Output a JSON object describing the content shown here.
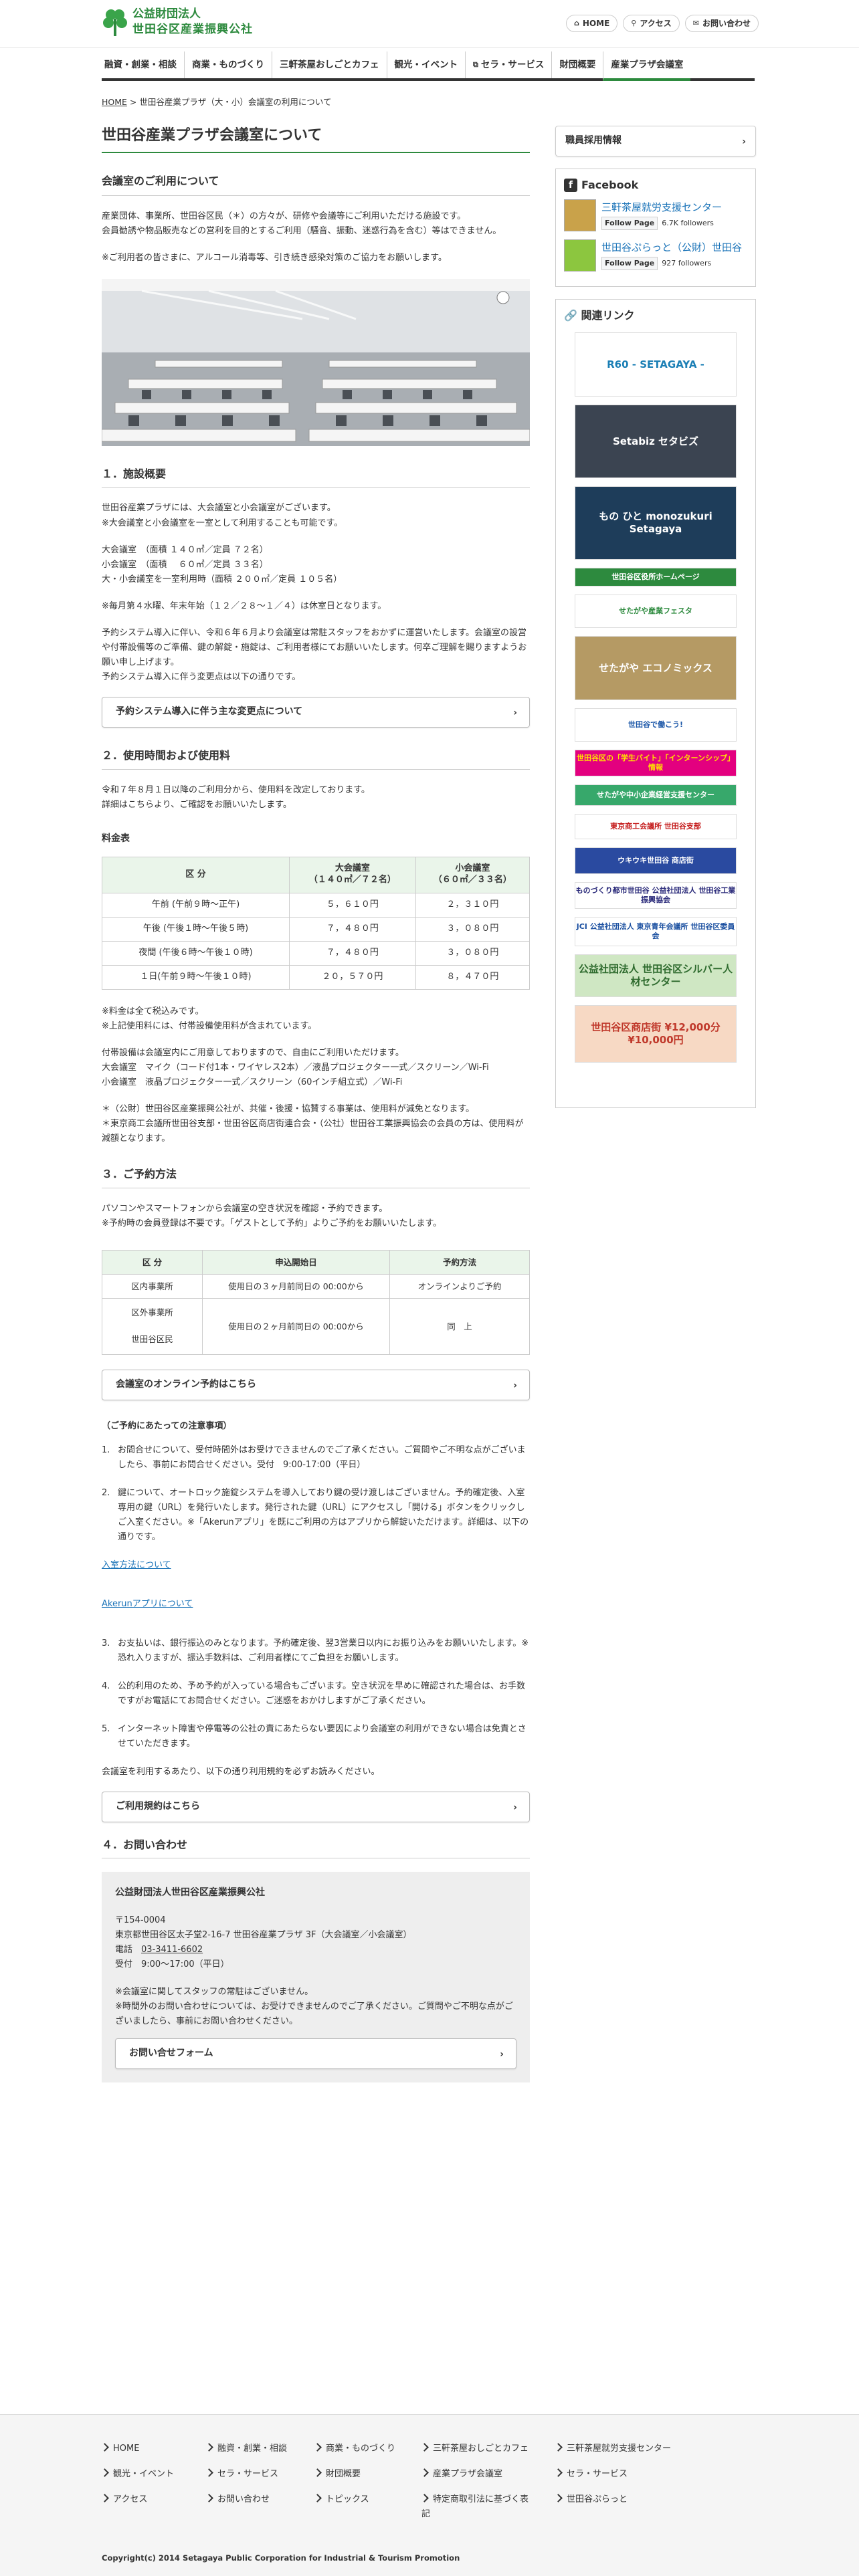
{
  "header": {
    "org_line1": "公益財団法人",
    "org_line2": "世田谷区産業振興公社",
    "links": [
      "HOME",
      "アクセス",
      "お問い合わせ"
    ]
  },
  "nav": [
    "融資・創業・相談",
    "商業・ものづくり",
    "三軒茶屋おしごとカフェ",
    "観光・イベント",
    "セラ・サービス",
    "財団概要",
    "産業プラザ会議室"
  ],
  "breadcrumb": {
    "home": "HOME",
    "sep": ">",
    "current": "世田谷産業プラザ（大・小）会議室の利用について"
  },
  "main": {
    "title": "世田谷産業プラザ会議室について",
    "usage_heading": "会議室のご利用について",
    "usage_p1": "産業団体、事業所、世田谷区民（＊）の方々が、研修や会議等にご利用いただける施設です。",
    "usage_p2": "会員勧誘や物品販売などの営利を目的とするご利用（騒音、振動、迷惑行為を含む）等はできません。",
    "usage_p3": "※ご利用者の皆さまに、アルコール消毒等、引き続き感染対策のご協力をお願いします。",
    "s1_title": "１．施設概要",
    "s1_p1": "世田谷産業プラザには、大会議室と小会議室がございます。",
    "s1_p2": "※大会議室と小会議室を一室として利用することも可能です。",
    "s1_l1": "大会議室　（面積 １４０㎡／定員 ７２名）",
    "s1_l2": "小会議室　（面積　 ６０㎡／定員 ３３名）",
    "s1_l3": "大・小会議室を一室利用時（面積 ２００㎡／定員 １０５名）",
    "s1_p3": "※毎月第４水曜、年末年始（１２／２８〜１／４）は休室日となります。",
    "s1_p4": "予約システム導入に伴い、令和６年６月より会議室は常駐スタッフをおかずに運営いたします。会議室の設営や付帯設備等のご準備、鍵の解錠・施錠は、ご利用者様にてお願いいたします。何卒ご理解を賜りますようお願い申し上げます。",
    "s1_p5": "予約システム導入に伴う変更点は以下の通りです。",
    "btn_changes": "予約システム導入に伴う主な変更点について",
    "s2_title": "２．使用時間および使用料",
    "s2_p1": "令和７年８月１日以降のご利用分から、使用料を改定しております。",
    "s2_p2": "詳細はこちらより、ご確認をお願いいたします。",
    "fee_heading": "料金表",
    "fee_headers": [
      "区 分",
      "大会議室\n（１４０㎡／７２名）",
      "小会議室\n（６０㎡／３３名）"
    ],
    "fee_rows": [
      [
        "午前 (午前９時〜正午)",
        "５，６１０円",
        "２，３１０円"
      ],
      [
        "午後 (午後１時〜午後５時)",
        "７，４８０円",
        "３，０８０円"
      ],
      [
        "夜間 (午後６時〜午後１０時)",
        "７，４８０円",
        "３，０８０円"
      ],
      [
        "１日(午前９時〜午後１０時)",
        "２０，５７０円",
        "８，４７０円"
      ]
    ],
    "fee_n1": "※料金は全て税込みです。",
    "fee_n2": "※上記使用料には、付帯設備使用料が含まれています。",
    "equip_p1": "付帯設備は会議室内にご用意しておりますので、自由にご利用いただけます。",
    "equip_p2": "大会議室　マイク（コード付1本・ワイヤレス2本）／液晶プロジェクター一式／スクリーン／Wi-Fi",
    "equip_p3": "小会議室　液晶プロジェクター一式／スクリーン（60インチ組立式）／Wi-Fi",
    "member_p1": "＊（公財）世田谷区産業振興公社が、共催・後援・協賛する事業は、使用料が減免となります。",
    "member_p2": "＊東京商工会議所世田谷支部・世田谷区商店街連合会・（公社）世田谷工業振興協会の会員の方は、使用料が減額となります。",
    "s3_title": "３．ご予約方法",
    "s3_p1": "パソコンやスマートフォンから会議室の空き状況を確認・予約できます。",
    "s3_p2": "※予約時の会員登録は不要です。「ゲストとして予約」よりご予約をお願いいたします。",
    "rs_headers": [
      "区 分",
      "申込開始日",
      "予約方法"
    ],
    "rs_r1": [
      "区内事業所",
      "使用日の３ヶ月前同日の 00:00から",
      "オンラインよりご予約"
    ],
    "rs_r2a": "区外事業所",
    "rs_r2b": "世田谷区民",
    "rs_r2_start": "使用日の２ヶ月前同日の 00:00から",
    "rs_r2_method": "同　上",
    "btn_online": "会議室のオンライン予約はこちら",
    "notes_heading": "（ご予約にあたっての注意事項）",
    "notes": [
      {
        "n": "1.",
        "t": "お問合せについて、受付時間外はお受けできませんのでご了承ください。ご質問やご不明な点がございましたら、事前にお問合せください。受付　9:00-17:00（平日）"
      },
      {
        "n": "2.",
        "t": "鍵について、オートロック施錠システムを導入しており鍵の受け渡しはございません。予約確定後、入室専用の鍵（URL）を発行いたします。発行された鍵（URL）にアクセスし「開ける」ボタンをクリックしご入室ください。※「Akerunアプリ」を既にご利用の方はアプリから解錠いただけます。詳細は、以下の通りです。"
      }
    ],
    "link_enter": "入室方法について",
    "link_akerun": "Akerunアプリについて",
    "notes2": [
      {
        "n": "3.",
        "t": "お支払いは、銀行振込のみとなります。予約確定後、翌3営業日以内にお振り込みをお願いいたします。※恐れ入りますが、振込手数料は、ご利用者様にてご負担をお願いします。"
      },
      {
        "n": "4.",
        "t": "公的利用のため、予め予約が入っている場合もございます。空き状況を早めに確認された場合は、お手数ですがお電話にてお問合せください。ご迷惑をおかけしますがご了承ください。"
      },
      {
        "n": "5.",
        "t": "インターネット障害や停電等の公社の責にあたらない要因により会議室の利用ができない場合は免責とさせていただきます。"
      }
    ],
    "terms_p": "会議室を利用するあたり、以下の通り利用規約を必ずお読みください。",
    "btn_terms": "ご利用規約はこちら",
    "s4_title": "４．お問い合わせ",
    "contact_org": "公益財団法人世田谷区産業振興公社",
    "contact_zip": "〒154-0004",
    "contact_addr": "東京都世田谷区太子堂2-16-7 世田谷産業プラザ 3F（大会議室／小会議室）",
    "contact_tel_label": "電話",
    "contact_tel": "03-3411-6602",
    "contact_hours": "受付　9:00〜17:00（平日）",
    "contact_n1": "※会議室に関してスタッフの常駐はございません。",
    "contact_n2": "※時間外のお問い合わせについては、お受けできませんのでご了承ください。ご質問やご不明な点がございましたら、事前にお問い合わせください。",
    "btn_form": "お問い合せフォーム"
  },
  "side": {
    "recruit": "職員採用情報",
    "fb_title": "Facebook",
    "fb_pages": [
      {
        "name": "三軒茶屋就労支援センター",
        "btn": "Follow Page",
        "count": "6.7K followers"
      },
      {
        "name": "世田谷ぷらっと（公財）世田谷",
        "btn": "Follow Page",
        "count": "927 followers"
      }
    ],
    "rel_title": "関連リンク",
    "banners": [
      {
        "t": "R60 - SETAGAYA -",
        "bg": "#ffffff",
        "fg": "#1b7fb5"
      },
      {
        "t": "Setabiz セタビズ",
        "bg": "#3b4451",
        "fg": "#ffffff"
      },
      {
        "t": "もの ひと monozukuri Setagaya",
        "bg": "#1e3d5a",
        "fg": "#ffffff"
      },
      {
        "t": "世田谷区役所ホームページ",
        "bg": "#2d8a3e",
        "fg": "#ffffff"
      },
      {
        "t": "せたがや産業フェスタ",
        "bg": "#ffffff",
        "fg": "#2d8a3e"
      },
      {
        "t": "せたがや エコノミックス",
        "bg": "#b59a64",
        "fg": "#ffffff"
      },
      {
        "t": "世田谷で働こう!",
        "bg": "#ffffff",
        "fg": "#1a56a8"
      },
      {
        "t": "世田谷区の「学生バイト」「インターンシップ」情報",
        "bg": "#e3007f",
        "fg": "#ffe000"
      },
      {
        "t": "せたがや中小企業経営支援センター",
        "bg": "#37a86b",
        "fg": "#ffffff"
      },
      {
        "t": "東京商工会議所 世田谷支部",
        "bg": "#ffffff",
        "fg": "#c41a1a"
      },
      {
        "t": "ウキウキ世田谷 商店街",
        "bg": "#2a4aa0",
        "fg": "#ffffff"
      },
      {
        "t": "ものづくり都市世田谷 公益社団法人 世田谷工業振興協会",
        "bg": "#ffffff",
        "fg": "#2a2a7a"
      },
      {
        "t": "JCI 公益社団法人 東京青年会議所 世田谷区委員会",
        "bg": "#ffffff",
        "fg": "#1a4fa0"
      },
      {
        "t": "公益社団法人 世田谷区シルバー人材センター",
        "bg": "#cfe7c3",
        "fg": "#2d6a2d"
      },
      {
        "t": "世田谷区商店街 ¥12,000分 ¥10,000円",
        "bg": "#f7d9c4",
        "fg": "#c0392b"
      }
    ]
  },
  "footer": {
    "col1": [
      "HOME",
      "観光・イベント",
      "アクセス"
    ],
    "col2": [
      "融資・創業・相談",
      "セラ・サービス",
      "お問い合わせ"
    ],
    "col3": [
      "商業・ものづくり",
      "財団概要",
      "トピックス"
    ],
    "col4": [
      "三軒茶屋おしごとカフェ",
      "産業プラザ会議室",
      "特定商取引法に基づく表記"
    ],
    "col5": [
      "三軒茶屋就労支援センター",
      "セラ・サービス",
      "世田谷ぷらっと"
    ],
    "copyright": "Copyright(c) 2014 Setagaya Public Corporation for Industrial & Tourism Promotion"
  },
  "colors": {
    "brand_green": "#2d8a3e",
    "link_blue": "#1a73b8",
    "table_head": "#eaf5ea"
  }
}
